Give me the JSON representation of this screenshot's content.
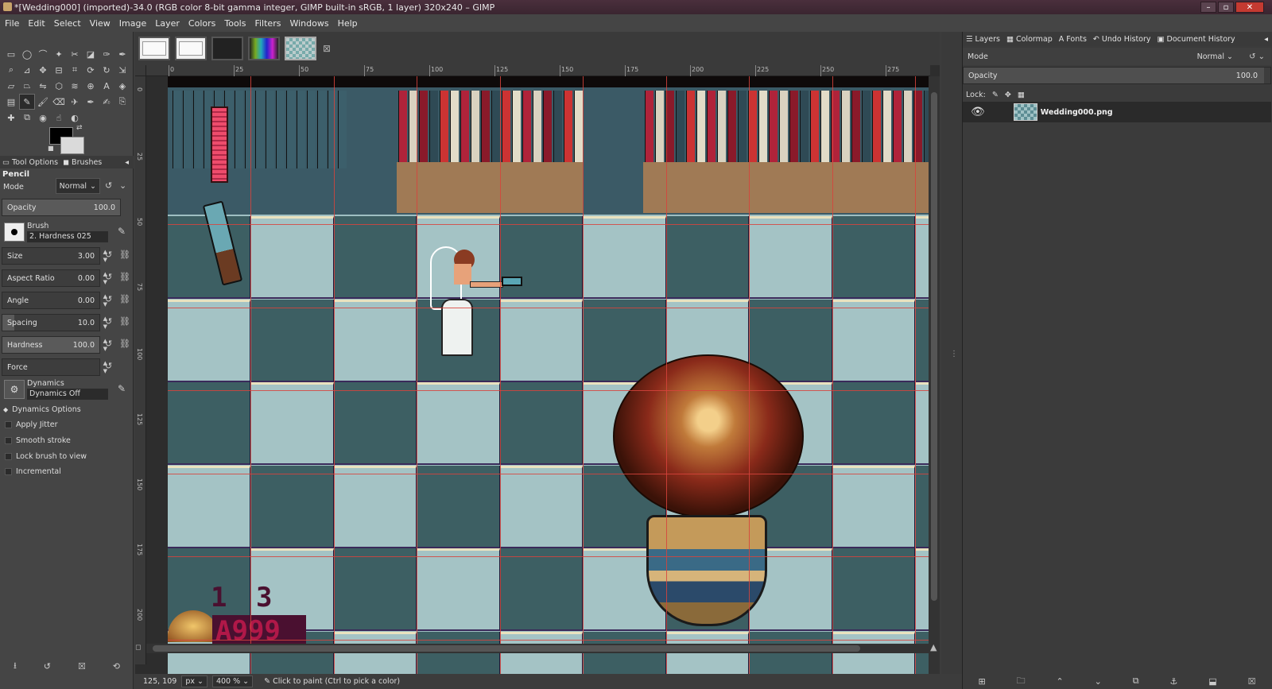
{
  "window": {
    "title": "*[Wedding000] (imported)-34.0 (RGB color 8-bit gamma integer, GIMP built-in sRGB, 1 layer) 320x240 – GIMP",
    "minimize_icon": "minimize-icon",
    "maximize_icon": "maximize-icon",
    "close_icon": "close-icon"
  },
  "menubar": [
    "File",
    "Edit",
    "Select",
    "View",
    "Image",
    "Layer",
    "Colors",
    "Tools",
    "Filters",
    "Windows",
    "Help"
  ],
  "toolbox": {
    "tool_icons": [
      "rect-select-icon",
      "ellipse-select-icon",
      "free-select-icon",
      "fuzzy-select-icon",
      "scissors-icon",
      "foreground-select-icon",
      "paths-icon",
      "color-picker-icon",
      "zoom-icon",
      "measure-icon",
      "move-icon",
      "align-icon",
      "crop-icon",
      "unified-transform-icon",
      "rotate-icon",
      "scale-icon",
      "shear-icon",
      "perspective-icon",
      "flip-icon",
      "cage-icon",
      "warp-icon",
      "handle-transform-icon",
      "text-icon",
      "bucket-fill-icon",
      "gradient-icon",
      "pencil-icon",
      "paintbrush-icon",
      "eraser-icon",
      "airbrush-icon",
      "ink-icon",
      "mypaint-icon",
      "clone-icon",
      "heal-icon",
      "perspective-clone-icon",
      "blur-icon",
      "smudge-icon",
      "dodge-icon"
    ],
    "active_tool_index": 25,
    "fg_color": "#000000",
    "bg_color": "#dadada"
  },
  "tool_options": {
    "tabs": [
      "Tool Options",
      "Brushes"
    ],
    "title": "Pencil",
    "mode_label": "Mode",
    "mode_value": "Normal",
    "opacity_label": "Opacity",
    "opacity_value": "100.0",
    "opacity_fraction": 1.0,
    "brush_label": "Brush",
    "brush_name": "2. Hardness 025",
    "size_label": "Size",
    "size_value": "3.00",
    "aspect_label": "Aspect Ratio",
    "aspect_value": "0.00",
    "angle_label": "Angle",
    "angle_value": "0.00",
    "spacing_label": "Spacing",
    "spacing_value": "10.0",
    "hardness_label": "Hardness",
    "hardness_value": "100.0",
    "force_label": "Force",
    "dynamics_label": "Dynamics",
    "dynamics_value": "Dynamics Off",
    "dynamics_options": "Dynamics Options",
    "apply_jitter": "Apply Jitter",
    "smooth_stroke": "Smooth stroke",
    "lock_brush": "Lock brush to view",
    "incremental": "Incremental"
  },
  "ruler": {
    "top_labels": [
      "0",
      "25",
      "50",
      "75",
      "100",
      "125",
      "150",
      "175",
      "200",
      "225",
      "250",
      "275"
    ],
    "left_labels": [
      "0",
      "25",
      "50",
      "75",
      "100",
      "125",
      "150",
      "175",
      "200"
    ]
  },
  "game": {
    "hud_digits": "1 3",
    "hud_score": "A999"
  },
  "statusbar": {
    "coords": "125, 109",
    "unit": "px",
    "zoom": "400 %",
    "message": "Click to paint (Ctrl to pick a color)"
  },
  "right_dock": {
    "tabs": [
      "Layers",
      "Colormap",
      "Fonts",
      "Undo History",
      "Document History"
    ],
    "mode_label": "Mode",
    "mode_value": "Normal",
    "opacity_label": "Opacity",
    "opacity_value": "100.0",
    "lock_label": "Lock:",
    "layer_name": "Wedding000.png"
  }
}
